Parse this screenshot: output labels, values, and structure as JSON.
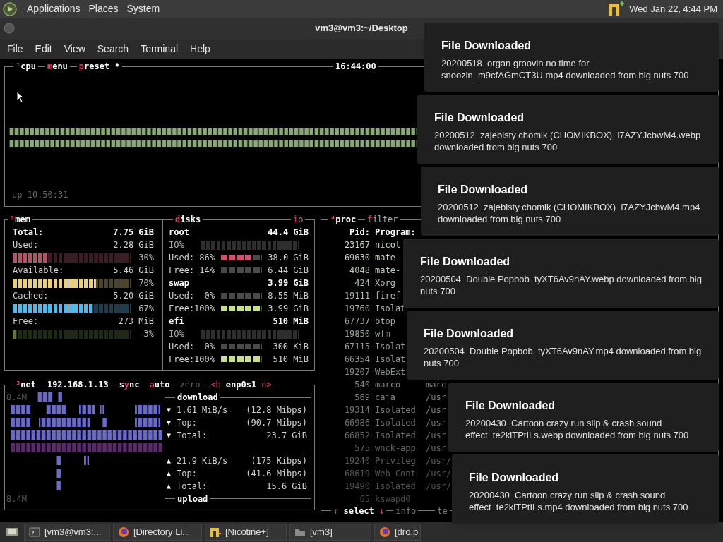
{
  "top_panel": {
    "menus": [
      "Applications",
      "Places",
      "System"
    ],
    "clock": "Wed Jan 22, 4:44 PM"
  },
  "terminal": {
    "title": "vm3@vm3:~/Desktop",
    "menu": [
      "File",
      "Edit",
      "View",
      "Search",
      "Terminal",
      "Help"
    ]
  },
  "cpu": {
    "tabs": [
      {
        "key": "¹",
        "post": "cpu"
      },
      {
        "key": "m",
        "post": "enu"
      },
      {
        "key": "p",
        "post": "reset *"
      }
    ],
    "clock": "16:44:00",
    "uptime": "up 10:50:31"
  },
  "mem": {
    "title": {
      "key": "²",
      "post": "mem"
    },
    "total": {
      "label": "Total:",
      "value": "7.75 GiB"
    },
    "rows": [
      {
        "label": "Used:",
        "value": "2.28 GiB",
        "percent": "30%",
        "level": 0.3,
        "color": "#b0566a"
      },
      {
        "label": "Available:",
        "value": "5.46 GiB",
        "percent": "70%",
        "level": 0.7,
        "color": "#e6cf80"
      },
      {
        "label": "Cached:",
        "value": "5.20 GiB",
        "percent": "67%",
        "level": 0.67,
        "color": "#52b8e6"
      },
      {
        "label": "Free:",
        "value": "273 MiB",
        "percent": "3%",
        "level": 0.03,
        "color": "#5c7a3c"
      }
    ]
  },
  "disks": {
    "title": {
      "key": "d",
      "post": "isks"
    },
    "io_tab": {
      "key": "i",
      "post": "o"
    },
    "items": [
      {
        "name": "root",
        "size": "44.4 GiB",
        "rows": [
          {
            "kind": "io",
            "label": "IO%"
          },
          {
            "kind": "meter",
            "label": "Used:",
            "percent": "86%",
            "level": 0.8,
            "value": "38.0 GiB",
            "color": "#d0506e"
          },
          {
            "kind": "meter",
            "label": "Free:",
            "percent": "14%",
            "value": "6.44 GiB"
          }
        ]
      },
      {
        "name": "swap",
        "size": "3.99 GiB",
        "rows": [
          {
            "kind": "meter",
            "label": "Used:",
            "percent": "0%",
            "value": "8.55 MiB"
          },
          {
            "kind": "meter",
            "label": "Free:",
            "percent": "100%",
            "level": 1,
            "value": "3.99 GiB",
            "color": "#c8e08a"
          }
        ]
      },
      {
        "name": "efi",
        "size": "510 MiB",
        "rows": [
          {
            "kind": "io",
            "label": "IO%"
          },
          {
            "kind": "meter",
            "label": "Used:",
            "percent": "0%",
            "value": "300 KiB"
          },
          {
            "kind": "meter",
            "label": "Free:",
            "percent": "100%",
            "level": 1,
            "value": "510 MiB",
            "color": "#c8e08a"
          }
        ]
      }
    ]
  },
  "net": {
    "title": {
      "key": "³",
      "post": "net"
    },
    "address": "192.168.1.13",
    "tabs": [
      {
        "pre": "s",
        "key": "y",
        "post": "nc",
        "on": true
      },
      {
        "key": "a",
        "post": "uto",
        "on": true
      },
      {
        "key": "z",
        "post": "ero",
        "on": false
      }
    ],
    "interface": {
      "prev": "<b",
      "name": "enp0s1",
      "next": "n>"
    },
    "scale_top": "8.4M",
    "scale_bottom": "8.4M",
    "download": {
      "title": "download",
      "rows": [
        {
          "arrow": "▼",
          "label": "1.61 MiB/s",
          "value": "(12.8 Mibps)"
        },
        {
          "arrow": "▼",
          "label": "Top:",
          "value": "(90.7 Mibps)"
        },
        {
          "arrow": "▼",
          "label": "Total:",
          "value": "23.7 GiB"
        }
      ]
    },
    "upload": {
      "title": "upload",
      "rows": [
        {
          "arrow": "▲",
          "label": "21.9 KiB/s",
          "value": "(175 Kibps)"
        },
        {
          "arrow": "▲",
          "label": "Top:",
          "value": "(41.6 Mibps)"
        },
        {
          "arrow": "▲",
          "label": "Total:",
          "value": "15.6 GiB"
        }
      ]
    }
  },
  "proc": {
    "title": {
      "key": "⁴",
      "post": "proc"
    },
    "filter": {
      "key": "f",
      "post": "ilter"
    },
    "columns": [
      "Pid:",
      "Program:"
    ],
    "rows": [
      {
        "pid": "23167",
        "program": "nicot"
      },
      {
        "pid": "69630",
        "program": "mate-"
      },
      {
        "pid": "4048",
        "program": "mate-"
      },
      {
        "pid": "424",
        "program": "Xorg"
      },
      {
        "pid": "19111",
        "program": "firef"
      },
      {
        "pid": "19760",
        "program": "Isolat"
      },
      {
        "pid": "67737",
        "program": "btop"
      },
      {
        "pid": "19850",
        "program": "wfm"
      },
      {
        "pid": "67115",
        "program": "Isolat"
      },
      {
        "pid": "66354",
        "program": "Isolat"
      },
      {
        "pid": "19207",
        "program": "WebExt"
      },
      {
        "pid": "540",
        "program": "marco",
        "column_3": "marc"
      },
      {
        "pid": "569",
        "program": "caja",
        "column_3": "/usr"
      },
      {
        "pid": "19314",
        "program": "Isolated",
        "column_3": "/usr"
      },
      {
        "pid": "66986",
        "program": "Isolated",
        "column_3": "/usr"
      },
      {
        "pid": "66852",
        "program": "Isolated",
        "column_3": "/usr"
      },
      {
        "pid": "575",
        "program": "wnck-app",
        "column_3": "/usr"
      },
      {
        "pid": "19240",
        "program": "Privileg",
        "column_3": "/usr/"
      },
      {
        "pid": "68619",
        "program": "Web Cont",
        "column_3": "/usr/"
      },
      {
        "pid": "19490",
        "program": "Isolated",
        "column_3": "/usr/"
      },
      {
        "pid": "65",
        "program": "kswapd0"
      }
    ],
    "footer": {
      "up": "↑",
      "select": "select",
      "down": "↓",
      "info": "info",
      "tab_3": "te"
    }
  },
  "notifications": [
    {
      "title": "File Downloaded",
      "body": "20200518_organ groovin no time for snoozin_m9cfAGmCT3U.mp4 downloaded from big nuts 700"
    },
    {
      "title": "File Downloaded",
      "body": "20200512_zajebisty chomik (CHOMIKBOX)_l7AZYJcbwM4.webp downloaded from big nuts 700"
    },
    {
      "title": "File Downloaded",
      "body": "20200512_zajebisty chomik (CHOMIKBOX)_l7AZYJcbwM4.mp4 downloaded from big nuts 700"
    },
    {
      "title": "File Downloaded",
      "body": "20200504_Double Popbob_tyXT6Av9nAY.webp downloaded from big nuts 700"
    },
    {
      "title": "File Downloaded",
      "body": "20200504_Double Popbob_tyXT6Av9nAY.mp4 downloaded from big nuts 700"
    },
    {
      "title": "File Downloaded",
      "body": "20200430_Cartoon crazy run slip & crash sound effect_te2klTPtILs.webp downloaded from big nuts 700"
    },
    {
      "title": "File Downloaded",
      "body": "20200430_Cartoon crazy run slip & crash sound effect_te2klTPtILs.mp4 downloaded from big nuts 700"
    }
  ],
  "taskbar": [
    {
      "kind": "terminal",
      "label": "[vm3@vm3:..."
    },
    {
      "kind": "browser",
      "label": "[Directory Li..."
    },
    {
      "kind": "nicotine",
      "label": "[Nicotine+]"
    },
    {
      "kind": "folder",
      "label": "[vm3]"
    },
    {
      "kind": "browser",
      "label": "[dro.p"
    }
  ]
}
